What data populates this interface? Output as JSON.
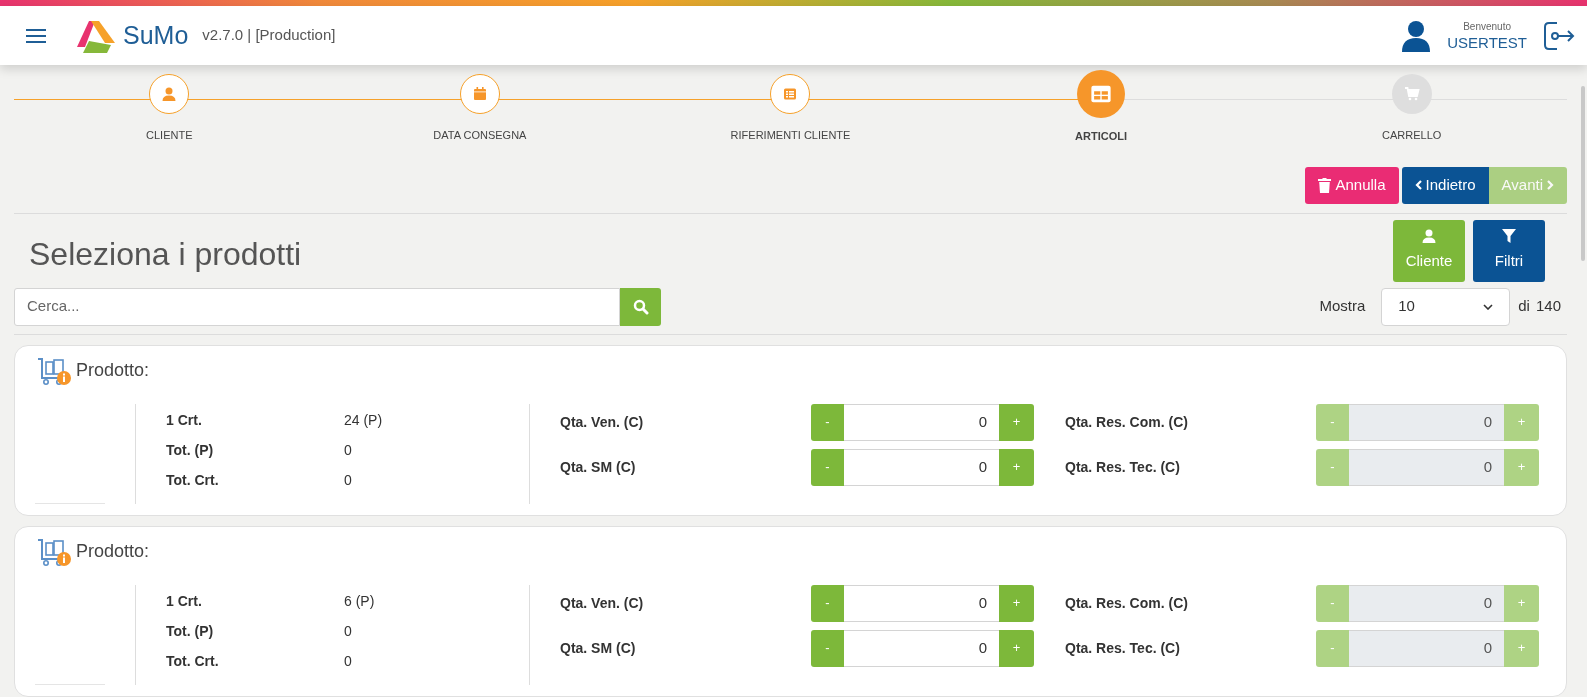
{
  "header": {
    "app_name": "SuMo",
    "version": "v2.7.0 | [Production]",
    "greeting": "Benvenuto",
    "user": "USERTEST"
  },
  "steps": [
    {
      "label": "CLIENTE",
      "done": true,
      "selected": false
    },
    {
      "label": "DATA CONSEGNA",
      "done": true,
      "selected": false
    },
    {
      "label": "RIFERIMENTI CLIENTE",
      "done": true,
      "selected": false
    },
    {
      "label": "ARTICOLI",
      "done": false,
      "selected": true
    },
    {
      "label": "CARRELLO",
      "done": false,
      "selected": false
    }
  ],
  "actions": [
    {
      "label": "Annulla",
      "kind": "cancel",
      "disabled": false
    },
    {
      "label": "Indietro",
      "kind": "back",
      "disabled": false
    },
    {
      "label": "Avanti",
      "kind": "next",
      "disabled": true
    }
  ],
  "title": "Seleziona i prodotti",
  "side_buttons": [
    {
      "label": "Cliente",
      "kind": "customer"
    },
    {
      "label": "Filtri",
      "kind": "filter"
    }
  ],
  "search": {
    "placeholder": "Cerca..."
  },
  "page_size": {
    "label": "Mostra",
    "value": "10",
    "of": "di",
    "total": "140"
  },
  "products": [
    {
      "title": "Prodotto:",
      "info": [
        {
          "label": "1 Crt.",
          "value": "24 (P)"
        },
        {
          "label": "Tot. (P)",
          "value": "0"
        },
        {
          "label": "Tot. Crt.",
          "value": "0"
        }
      ],
      "quantities": [
        {
          "label": "Qta. Ven. (C)",
          "minus": "-",
          "value": "0",
          "plus": "+",
          "disabled": false
        },
        {
          "label": "Qta. Res. Com. (C)",
          "minus": "-",
          "value": "0",
          "plus": "+",
          "disabled": true
        },
        {
          "label": "Qta. SM (C)",
          "minus": "-",
          "value": "0",
          "plus": "+",
          "disabled": false
        },
        {
          "label": "Qta. Res. Tec. (C)",
          "minus": "-",
          "value": "0",
          "plus": "+",
          "disabled": true
        }
      ]
    },
    {
      "title": "Prodotto:",
      "info": [
        {
          "label": "1 Crt.",
          "value": "6 (P)"
        },
        {
          "label": "Tot. (P)",
          "value": "0"
        },
        {
          "label": "Tot. Crt.",
          "value": "0"
        }
      ],
      "quantities": [
        {
          "label": "Qta. Ven. (C)",
          "minus": "-",
          "value": "0",
          "plus": "+",
          "disabled": false
        },
        {
          "label": "Qta. Res. Com. (C)",
          "minus": "-",
          "value": "0",
          "plus": "+",
          "disabled": true
        },
        {
          "label": "Qta. SM (C)",
          "minus": "-",
          "value": "0",
          "plus": "+",
          "disabled": false
        },
        {
          "label": "Qta. Res. Tec. (C)",
          "minus": "-",
          "value": "0",
          "plus": "+",
          "disabled": true
        }
      ]
    }
  ]
}
